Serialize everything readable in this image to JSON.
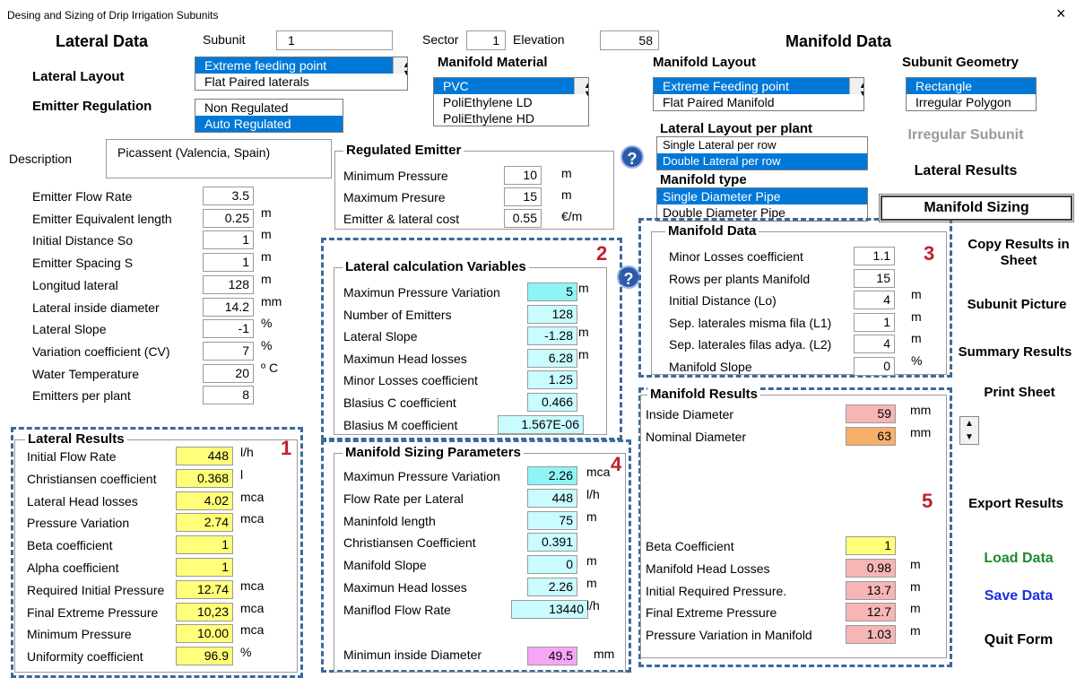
{
  "window": {
    "title": "Desing and Sizing of Drip Irrigation Subunits",
    "close": "×"
  },
  "headers": {
    "lateral_data": "Lateral Data",
    "manifold_data": "Manifold Data"
  },
  "subunit": {
    "label": "Subunit",
    "value": "1"
  },
  "sector": {
    "label": "Sector",
    "value": "1"
  },
  "elevation": {
    "label": "Elevation",
    "value": "58"
  },
  "lateral_layout": {
    "label": "Lateral Layout",
    "options": [
      "Extreme feeding point",
      "Flat Paired laterals"
    ]
  },
  "emitter_regulation": {
    "label": "Emitter Regulation",
    "options": [
      "Non Regulated",
      "Auto Regulated"
    ]
  },
  "manifold_material": {
    "label": "Manifold Material",
    "options": [
      "PVC",
      "PoliEthylene LD",
      "PoliEthylene HD"
    ]
  },
  "manifold_layout": {
    "label": "Manifold Layout",
    "options": [
      "Extreme Feeding point",
      "Flat Paired Manifold"
    ]
  },
  "subunit_geometry": {
    "label": "Subunit Geometry",
    "options": [
      "Rectangle",
      "Irregular Polygon"
    ]
  },
  "lateral_layout_per_plant": {
    "label": "Lateral Layout per plant",
    "options": [
      "Single Lateral per row",
      "Double Lateral per row"
    ]
  },
  "manifold_type": {
    "label": "Manifold type",
    "options": [
      "Single Diameter Pipe",
      "Double Diameter Pipe"
    ]
  },
  "description": {
    "label": "Description",
    "value": "Picassent (Valencia, Spain)"
  },
  "regulated_emitter": {
    "title": "Regulated Emitter",
    "rows": [
      {
        "label": "Minimum Pressure",
        "value": "10",
        "unit": "m"
      },
      {
        "label": "Maximum Presure",
        "value": "15",
        "unit": "m"
      },
      {
        "label": "Emitter & lateral cost",
        "value": "0.55",
        "unit": "€/m"
      }
    ]
  },
  "emitter_params": [
    {
      "label": "Emitter Flow Rate",
      "value": "3.5",
      "unit": ""
    },
    {
      "label": "Emitter Equivalent length",
      "value": "0.25",
      "unit": "m"
    },
    {
      "label": "Initial Distance So",
      "value": "1",
      "unit": "m"
    },
    {
      "label": "Emitter Spacing S",
      "value": "1",
      "unit": "m"
    },
    {
      "label": "Longitud lateral",
      "value": "128",
      "unit": "m"
    },
    {
      "label": "Lateral inside diameter",
      "value": "14.2",
      "unit": "mm"
    },
    {
      "label": "Lateral Slope",
      "value": "-1",
      "unit": "%"
    },
    {
      "label": "Variation coefficient (CV)",
      "value": "7",
      "unit": "%"
    },
    {
      "label": "Water Temperature",
      "value": "20",
      "unit": "º C"
    },
    {
      "label": "Emitters per plant",
      "value": "8",
      "unit": ""
    }
  ],
  "lateral_calc": {
    "title": "Lateral calculation Variables",
    "number": "2",
    "rows": [
      {
        "label": "Maximun Pressure Variation",
        "value": "5",
        "unit": "m"
      },
      {
        "label": "Number of Emitters",
        "value": "128",
        "unit": ""
      },
      {
        "label": "Lateral Slope",
        "value": "-1.28",
        "unit": "m"
      },
      {
        "label": "Maximun Head losses",
        "value": "6.28",
        "unit": "m"
      },
      {
        "label": "Minor Losses coefficient",
        "value": "1.25",
        "unit": ""
      },
      {
        "label": "Blasius C coefficient",
        "value": "0.466",
        "unit": ""
      },
      {
        "label": "Blasius M coefficient",
        "value": "1.567E-06",
        "unit": ""
      }
    ]
  },
  "manifold_data_box": {
    "title": "Manifold Data",
    "number": "3",
    "rows": [
      {
        "label": "Minor Losses coefficient",
        "value": "1.1",
        "unit": ""
      },
      {
        "label": "Rows per plants Manifold",
        "value": "15",
        "unit": ""
      },
      {
        "label": "Initial Distance (Lo)",
        "value": "4",
        "unit": "m"
      },
      {
        "label": "Sep. laterales misma fila (L1)",
        "value": "1",
        "unit": "m"
      },
      {
        "label": "Sep. laterales filas adya. (L2)",
        "value": "4",
        "unit": "m"
      },
      {
        "label": "Manifold Slope",
        "value": "0",
        "unit": "%"
      }
    ]
  },
  "lateral_results": {
    "title": "Lateral Results",
    "number": "1",
    "rows": [
      {
        "label": "Initial Flow Rate",
        "value": "448",
        "unit": "l/h"
      },
      {
        "label": "Christiansen coefficient",
        "value": "0.368",
        "unit": "l"
      },
      {
        "label": "Lateral Head losses",
        "value": "4.02",
        "unit": "mca"
      },
      {
        "label": "Pressure Variation",
        "value": "2.74",
        "unit": "mca"
      },
      {
        "label": "Beta coefficient",
        "value": "1",
        "unit": ""
      },
      {
        "label": "Alpha coefficient",
        "value": "1",
        "unit": ""
      },
      {
        "label": "Required Initial Pressure",
        "value": "12.74",
        "unit": "mca"
      },
      {
        "label": "Final Extreme Pressure",
        "value": "10,23",
        "unit": "mca"
      },
      {
        "label": "Minimum Pressure",
        "value": "10.00",
        "unit": "mca"
      },
      {
        "label": "Uniformity coefficient",
        "value": "96.9",
        "unit": "%"
      }
    ]
  },
  "manifold_sizing": {
    "title": "Manifold Sizing Parameters",
    "number": "4",
    "rows": [
      {
        "label": "Maximun Pressure Variation",
        "value": "2.26",
        "unit": "mca"
      },
      {
        "label": "Flow Rate per Lateral",
        "value": "448",
        "unit": "l/h"
      },
      {
        "label": "Maninfold length",
        "value": "75",
        "unit": "m"
      },
      {
        "label": "Christiansen Coefficient",
        "value": "0.391",
        "unit": ""
      },
      {
        "label": "Manifold Slope",
        "value": "0",
        "unit": "m"
      },
      {
        "label": "Maximun Head losses",
        "value": "2.26",
        "unit": "m"
      },
      {
        "label": "Maniflod Flow Rate",
        "value": "13440",
        "unit": "l/h"
      }
    ],
    "min_diameter": {
      "label": "Minimun inside Diameter",
      "value": "49.5",
      "unit": "mm"
    }
  },
  "manifold_results": {
    "title": "Manifold Results",
    "number": "5",
    "top": [
      {
        "label": "Inside Diameter",
        "value": "59",
        "unit": "mm"
      },
      {
        "label": "Nominal Diameter",
        "value": "63",
        "unit": "mm"
      }
    ],
    "bottom": [
      {
        "label": "Beta Coefficient",
        "value": "1",
        "unit": ""
      },
      {
        "label": "Manifold Head Losses",
        "value": "0.98",
        "unit": "m"
      },
      {
        "label": "Initial Required Pressure.",
        "value": "13.7",
        "unit": "m"
      },
      {
        "label": "Final Extreme Pressure",
        "value": "12.7",
        "unit": "m"
      },
      {
        "label": "Pressure Variation in Manifold",
        "value": "1.03",
        "unit": "m"
      }
    ]
  },
  "buttons": {
    "irregular_subunit": "Irregular Subunit",
    "lateral_results": "Lateral Results",
    "manifold_sizing": "Manifold Sizing",
    "copy_results": "Copy Results in Sheet",
    "subunit_picture": "Subunit Picture",
    "summary_results": "Summary Results",
    "print_sheet": "Print Sheet",
    "export_results": "Export Results",
    "load_data": "Load Data",
    "save_data": "Save Data",
    "quit_form": "Quit Form"
  },
  "help_icon": "?",
  "colors": {
    "load_data": "#1e8a2e",
    "save_data": "#1a2ee0",
    "disabled": "#9a9a9a",
    "section_number": "#c0202a",
    "dash": "#3c6a9a"
  }
}
